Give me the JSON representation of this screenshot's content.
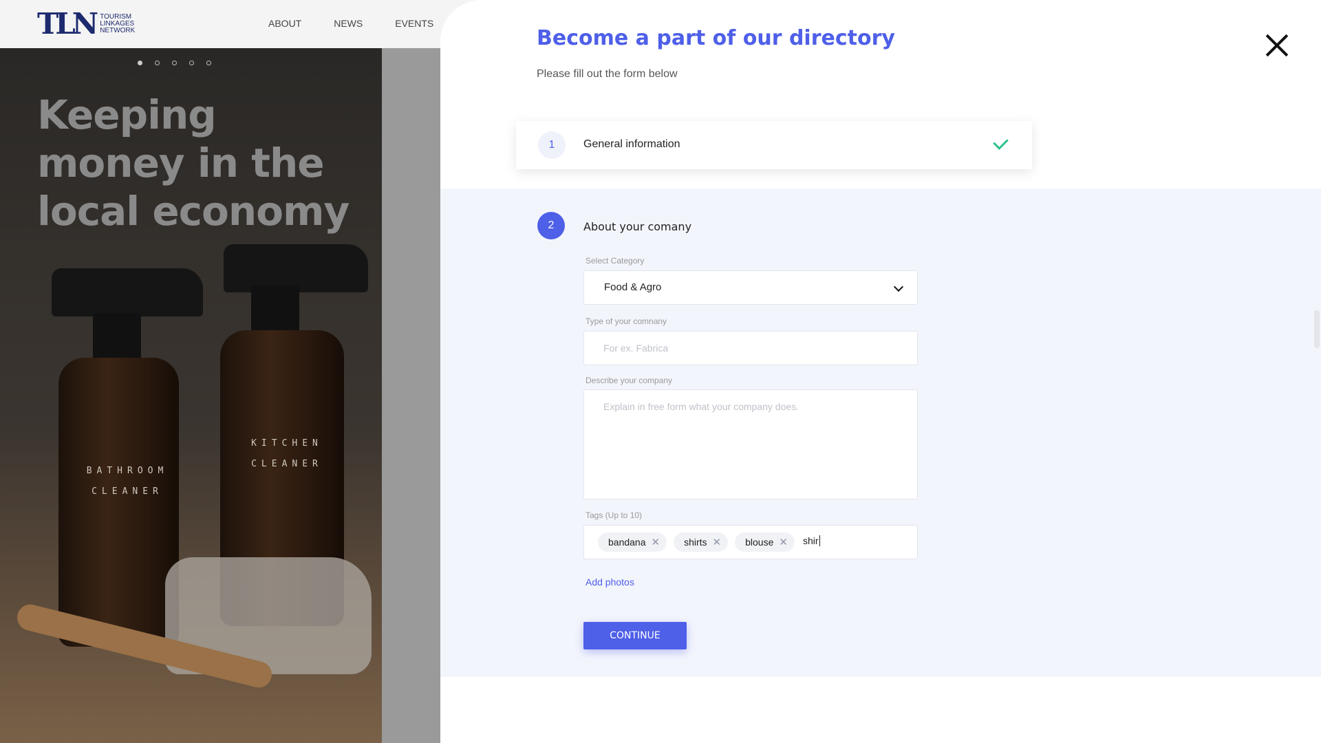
{
  "site": {
    "logo_mark": "TLN",
    "logo_text": [
      "TOURISM",
      "LINKAGES",
      "NETWORK"
    ],
    "nav": [
      "ABOUT",
      "NEWS",
      "EVENTS"
    ],
    "hero_title": "Keeping money in the local economy",
    "bottle_labels": {
      "left": "BATHROOM CLEANER",
      "right": "KITCHEN CLEANER"
    }
  },
  "modal": {
    "title": "Become a part of our directory",
    "subtitle": "Please fill out the form below",
    "close_icon": "close-icon",
    "step1": {
      "number": "1",
      "label": "General information",
      "status_icon": "check-icon",
      "status_color": "#2ec28a"
    },
    "step2": {
      "number": "2",
      "label": "About your comany",
      "category": {
        "label": "Select Category",
        "value": "Food & Agro"
      },
      "type": {
        "label": "Type of your comnany",
        "placeholder": "For ex. Fabrica",
        "value": ""
      },
      "description": {
        "label": "Describe your company",
        "placeholder": "Explain in free form what your company does.",
        "value": ""
      },
      "tags": {
        "label": "Tags (Up to 10)",
        "items": [
          "bandana",
          "shirts",
          "blouse"
        ],
        "typing": "shir"
      },
      "add_photos": "Add photos",
      "continue": "CONTINUE"
    }
  },
  "colors": {
    "accent": "#4e5fe8",
    "success": "#2ec28a",
    "step_bg": "#f3f5fc"
  }
}
